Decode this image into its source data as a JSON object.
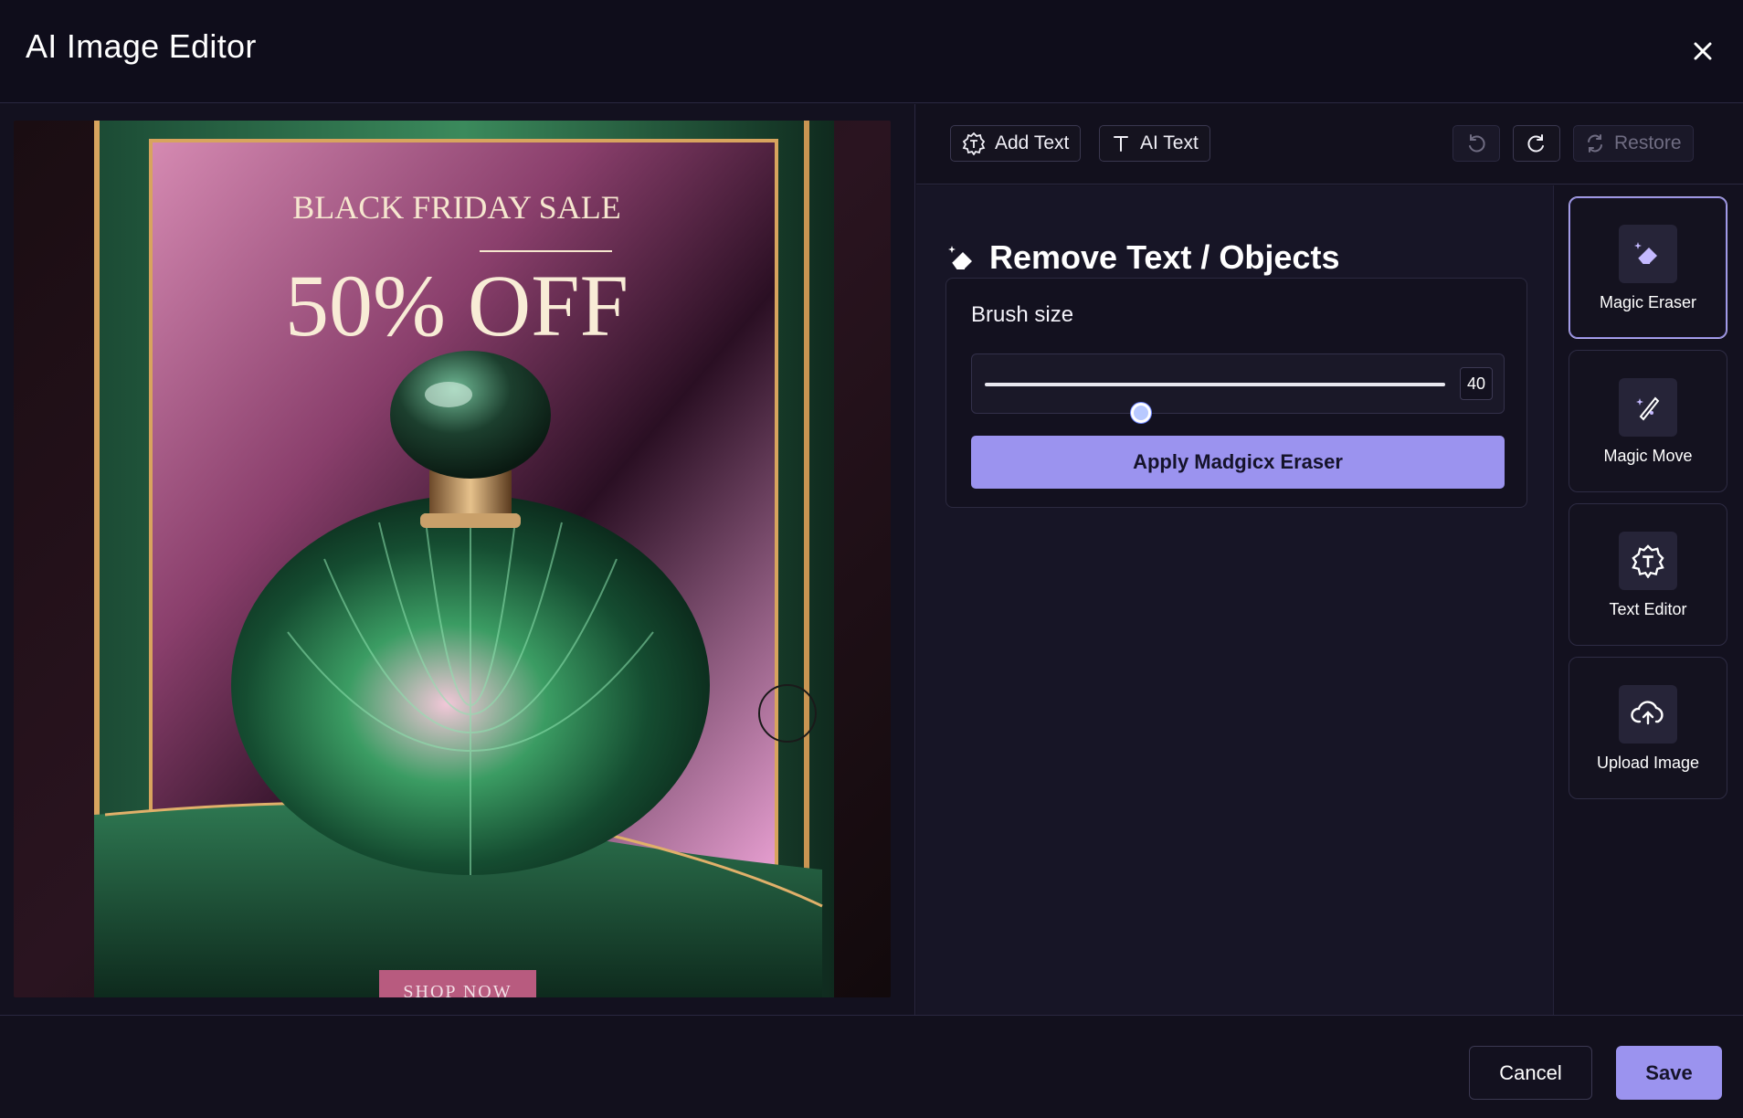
{
  "header": {
    "title": "AI Image Editor",
    "close_icon": "close-icon"
  },
  "image": {
    "headline": "BLACK FRIDAY SALE",
    "offer": "50% OFF",
    "cta": "SHOP NOW"
  },
  "toolbar": {
    "add_text_label": "Add Text",
    "ai_text_label": "AI Text",
    "undo_icon": "undo-icon",
    "redo_icon": "redo-icon",
    "restore_label": "Restore"
  },
  "panel": {
    "title": "Remove Text / Objects",
    "brush_label": "Brush size",
    "brush_value": "40",
    "brush_fraction": 0.34,
    "apply_label": "Apply Madgicx Eraser"
  },
  "tools": [
    {
      "label": "Magic Eraser",
      "icon": "eraser-icon",
      "active": true
    },
    {
      "label": "Magic Move",
      "icon": "magic-wand-icon",
      "active": false
    },
    {
      "label": "Text Editor",
      "icon": "text-badge-icon",
      "active": false
    },
    {
      "label": "Upload Image",
      "icon": "cloud-upload-icon",
      "active": false
    }
  ],
  "footer": {
    "cancel_label": "Cancel",
    "save_label": "Save"
  },
  "colors": {
    "accent": "#9b93ef",
    "background": "#13111f"
  }
}
